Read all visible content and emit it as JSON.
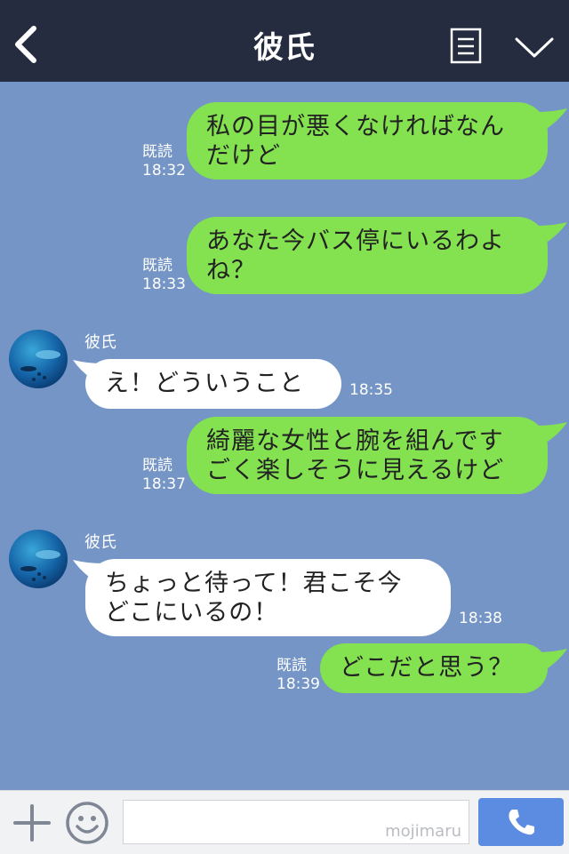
{
  "header": {
    "title": "彼氏"
  },
  "messages": [
    {
      "dir": "out",
      "text": "私の目が悪くなければなん\nだけど",
      "read": "既読",
      "time": "18:32"
    },
    {
      "dir": "out",
      "text": "あなた今バス停にいるわよ\nね？",
      "read": "既読",
      "time": "18:33"
    },
    {
      "dir": "in",
      "sender": "彼氏",
      "text": "え！どういうこと",
      "time": "18:35"
    },
    {
      "dir": "out",
      "text": "綺麗な女性と腕を組んです\nごく楽しそうに見えるけど",
      "read": "既読",
      "time": "18:37"
    },
    {
      "dir": "in",
      "sender": "彼氏",
      "text": "ちょっと待って！君こそ今\nどこにいるの！",
      "time": "18:38"
    },
    {
      "dir": "out",
      "text": "どこだと思う？",
      "read": "既読",
      "time": "18:39"
    }
  ],
  "footer": {
    "input_value": "",
    "watermark": "mojimaru"
  },
  "colors": {
    "header": "#252c3f",
    "chat_bg": "#7495c5",
    "out_bubble": "#84e251",
    "in_bubble": "#ffffff",
    "send": "#5c8be2"
  },
  "icons": [
    "back-chevron-icon",
    "menu-list-icon",
    "chevron-down-icon",
    "plus-icon",
    "smiley-icon",
    "phone-icon"
  ]
}
